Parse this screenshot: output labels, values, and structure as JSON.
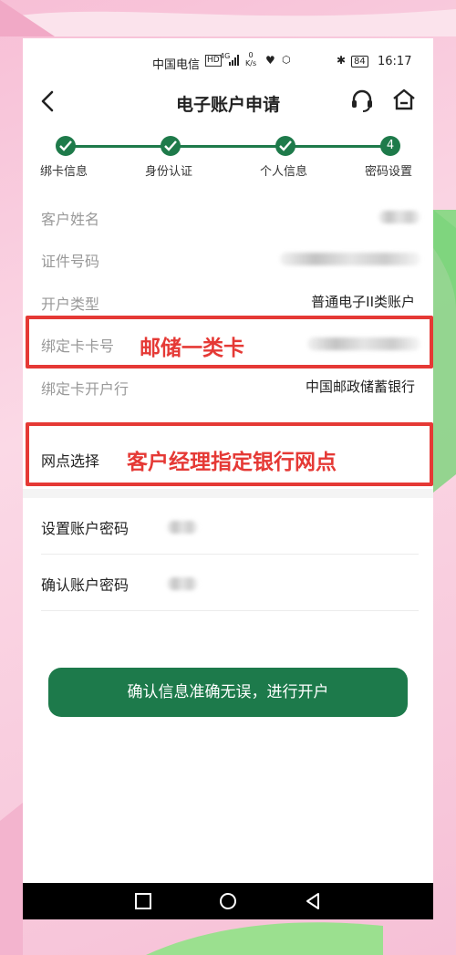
{
  "status_bar": {
    "carrier": "中国电信",
    "hd": "HD",
    "network": "4G",
    "speed_value": "0",
    "speed_unit": "K/s",
    "battery": "84",
    "time": "16:17"
  },
  "header": {
    "title": "电子账户申请"
  },
  "steps": [
    {
      "label": "绑卡信息",
      "state": "done"
    },
    {
      "label": "身份认证",
      "state": "done"
    },
    {
      "label": "个人信息",
      "state": "done"
    },
    {
      "label": "密码设置",
      "state": "current",
      "number": "4"
    }
  ],
  "fields": {
    "customer_name": {
      "label": "客户姓名"
    },
    "id_number": {
      "label": "证件号码"
    },
    "account_type": {
      "label": "开户类型",
      "value": "普通电子II类账户"
    },
    "bound_card": {
      "label": "绑定卡卡号"
    },
    "bound_bank": {
      "label": "绑定卡开户行",
      "value": "中国邮政储蓄银行"
    },
    "branch": {
      "label": "网点选择"
    },
    "set_password": {
      "label": "设置账户密码"
    },
    "confirm_password": {
      "label": "确认账户密码"
    }
  },
  "annotations": {
    "card_note": "邮储一类卡",
    "branch_note": "客户经理指定银行网点"
  },
  "submit": {
    "label": "确认信息准确无误，进行开户"
  },
  "colors": {
    "brand_green": "#1d7a4b",
    "annotation_red": "#e53935",
    "background_pink": "#f6c6da"
  }
}
